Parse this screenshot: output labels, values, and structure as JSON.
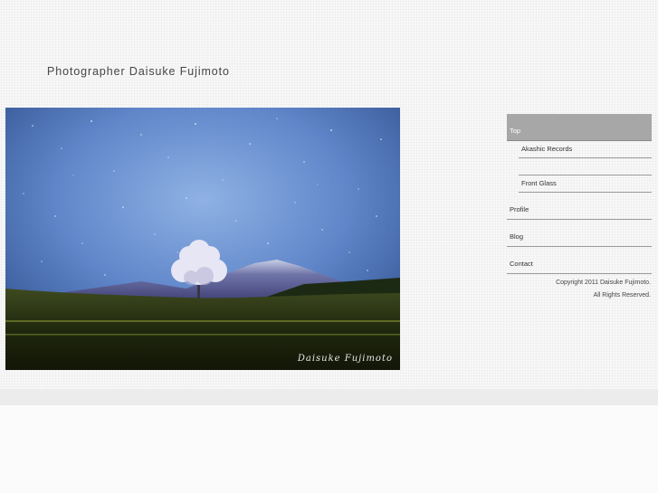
{
  "header": {
    "site_title": "Photographer Daisuke Fujimoto"
  },
  "photo": {
    "watermark": "Daisuke Fujimoto"
  },
  "nav": {
    "top": "Top",
    "akashic": "Akashic Records",
    "front_glass": "Front Glass",
    "profile": "Profile",
    "blog": "Blog",
    "contact": "Contact"
  },
  "footer": {
    "copyright_line1": "Copyright 2011 Daisuke Fujimoto.",
    "copyright_line2": "All Rights Reserved."
  },
  "colors": {
    "nav_active_bg": "#a7a7a7",
    "divider": "#9a9a9a",
    "page_bg": "#f6f6f6"
  }
}
